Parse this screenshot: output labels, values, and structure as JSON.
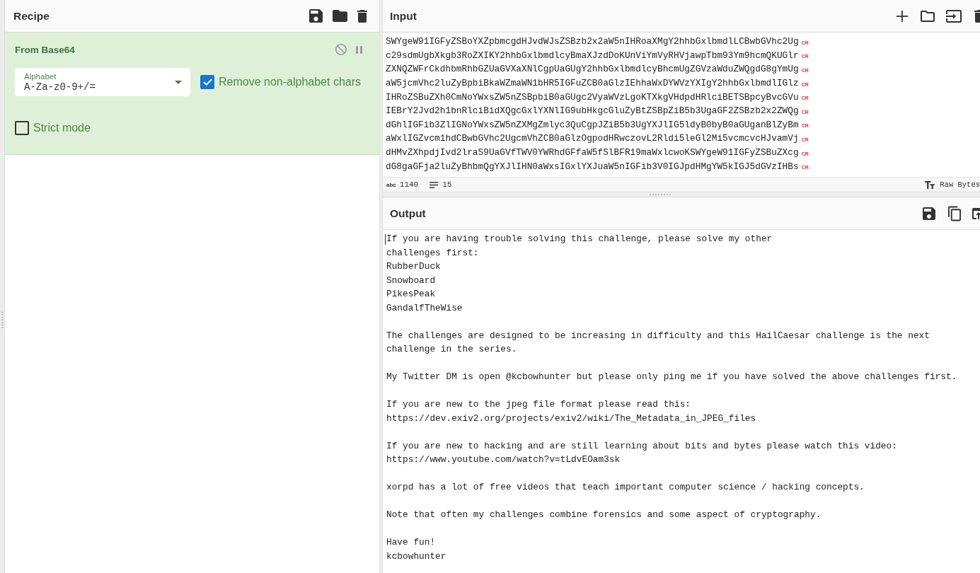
{
  "recipe": {
    "title": "Recipe",
    "operations": [
      {
        "name": "From Base64",
        "args": [
          {
            "kind": "dropdown",
            "label": "Alphabet",
            "value": "A-Za-z0-9+/="
          },
          {
            "kind": "checkbox",
            "label": "Remove non-alphabet chars",
            "checked": true
          },
          {
            "kind": "checkbox",
            "label": "Strict mode",
            "checked": false
          }
        ]
      }
    ]
  },
  "input": {
    "title": "Input",
    "lines": [
      {
        "text": "SWYgeW91IGFyZSBoYXZpbmcgdHJvdWJsZSBzb2x2aW5nIHRoaXMgY2hhbGxlbmdlLCBwbGVhc2Ug",
        "end_mark": "CR"
      },
      {
        "text": "c29sdmUgbXkgb3RoZXIKY2hhbGxlbmdlcyBmaXJzdDoKUnViYmVyRHVjawpTbm93Ym9hcmQKUGlr",
        "end_mark": "CR"
      },
      {
        "text": "ZXNQZWFrCkdhbmRhbGZUaGVXaXNlCgpUaGUgY2hhbGxlbmdlcyBhcmUgZGVzaWduZWQgdG8gYmUg",
        "end_mark": "CR"
      },
      {
        "text": "aW5jcmVhc2luZyBpbiBkaWZmaWN1bHR5IGFuZCB0aGlzIEhhaWxDYWVzYXIgY2hhbGxlbmdlIGlz",
        "end_mark": "CR"
      },
      {
        "text": "IHRoZSBuZXh0CmNoYWxsZW5nZSBpbiB0aGUgc2VyaWVzLgoKTXkgVHdpdHRlciBETSBpcyBvcGVu",
        "end_mark": "CR"
      },
      {
        "text": "IEBrY2Jvd2h1bnRlciBidXQgcGxlYXNlIG9ubHkgcGluZyBtZSBpZiB5b3UgaGF2ZSBzb2x2ZWQg",
        "end_mark": "CR"
      },
      {
        "text": "dGhlIGFib3ZlIGNoYWxsZW5nZXMgZmlyc3QuCgpJZiB5b3UgYXJlIG5ldyB0byB0aGUganBlZyBm",
        "end_mark": "CR"
      },
      {
        "text": "aWxlIGZvcm1hdCBwbGVhc2UgcmVhZCB0aGlzOgpodHRwczovL2Rldi5leGl2Mi5vcmcvcHJvamVj",
        "end_mark": "CR"
      },
      {
        "text": "dHMvZXhpdjIvd2lraS9UaGVfTWV0YWRhdGFfaW5fSlBFR19maWxlcwoKSWYgeW91IGFyZSBuZXcg",
        "end_mark": "CR"
      },
      {
        "text": "dG8gaGFja2luZyBhbmQgYXJlIHN0aWxsIGxlYXJuaW5nIGFib3V0IGJpdHMgYW5kIGJ5dGVzIHBs",
        "end_mark": "CR"
      }
    ],
    "status_bar": {
      "length_icon": "abc",
      "length": "1140",
      "line_count": "15",
      "encoding": "Raw Bytes"
    }
  },
  "output": {
    "title": "Output",
    "paragraphs": [
      [
        "If you are having trouble solving this challenge, please solve my other",
        "challenges first:",
        "RubberDuck",
        "Snowboard",
        "PikesPeak",
        "GandalfTheWise"
      ],
      [
        "The challenges are designed to be increasing in difficulty and this HailCaesar challenge is the next",
        "challenge in the series."
      ],
      [
        "My Twitter DM is open @kcbowhunter but please only ping me if you have solved the above challenges first."
      ],
      [
        "If you are new to the jpeg file format please read this:",
        "https://dev.exiv2.org/projects/exiv2/wiki/The_Metadata_in_JPEG_files"
      ],
      [
        "If you are new to hacking and are still learning about bits and bytes please watch this video:",
        "https://www.youtube.com/watch?v=tLdvEOam3sk"
      ],
      [
        "xorpd has a lot of free videos that teach important computer science / hacking concepts."
      ],
      [
        "Note that often my challenges combine forensics and some aspect of cryptography."
      ],
      [
        "Have fun!",
        "kcbowhunter"
      ]
    ]
  }
}
